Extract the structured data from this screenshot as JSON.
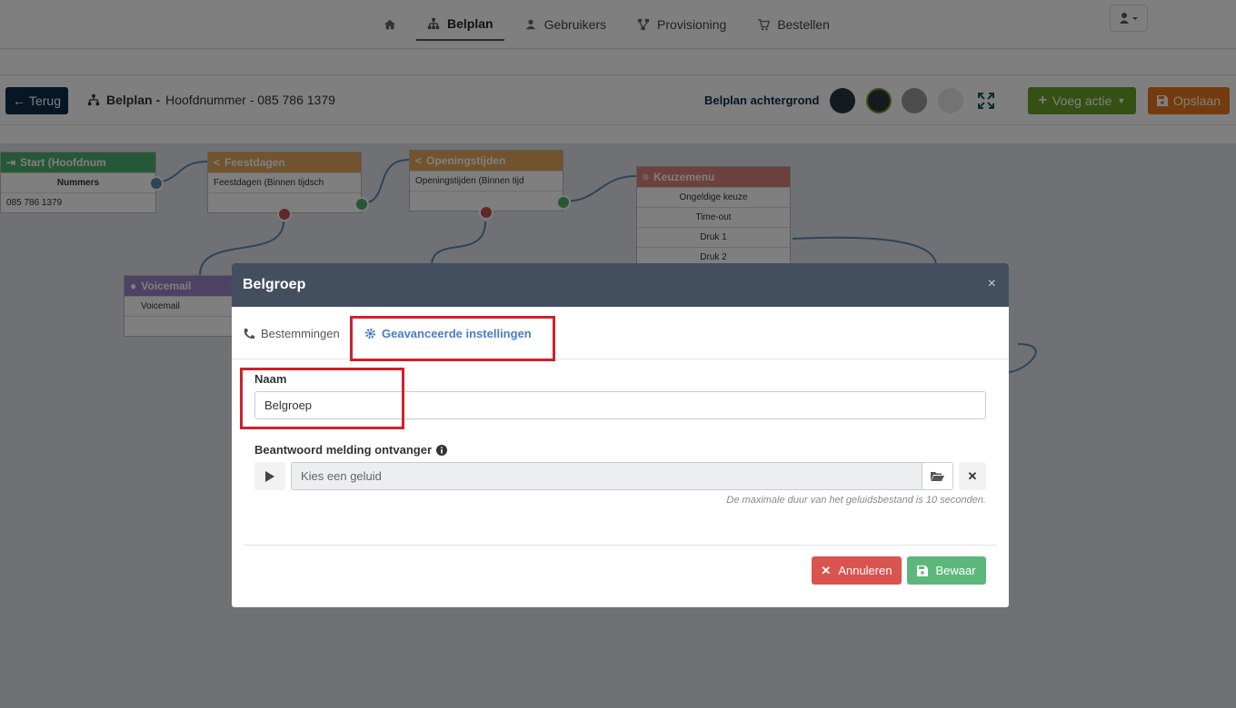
{
  "nav": {
    "items": [
      {
        "label": "",
        "icon": "home-icon"
      },
      {
        "label": "Belplan",
        "icon": "sitemap-icon",
        "active": true
      },
      {
        "label": "Gebruikers",
        "icon": "users-icon"
      },
      {
        "label": "Provisioning",
        "icon": "network-icon"
      },
      {
        "label": "Bestellen",
        "icon": "cart-icon"
      }
    ]
  },
  "toolbar": {
    "back_label": "Terug",
    "breadcrumb_bold": "Belplan -",
    "breadcrumb_rest": "Hoofdnummer - 085 786 1379",
    "background_label": "Belplan achtergrond",
    "swatches": [
      "#2b3540",
      "#2b3540",
      "#9a9a9a",
      "#e6e6e6"
    ],
    "add_action_label": "Voeg actie",
    "save_label": "Opslaan"
  },
  "nodes": {
    "start": {
      "title": "Start (Hoofdnum",
      "row1": "Nummers",
      "row2": "085 786 1379",
      "color": "#4caf6f"
    },
    "holidays": {
      "title": "Feestdagen",
      "row1": "Feestdagen (Binnen tijdsch",
      "color": "#e2a85a"
    },
    "hours": {
      "title": "Openingstijden",
      "row1": "Openingstijden (Binnen tijd",
      "color": "#e2a85a"
    },
    "menu": {
      "title": "Keuzemenu",
      "rows": [
        "Ongeldige keuze",
        "Time-out",
        "Druk 1",
        "Druk 2"
      ],
      "color": "#d9827d"
    },
    "voicemail": {
      "title": "Voicemail",
      "row1": "Voicemail",
      "color": "#9b84c9"
    }
  },
  "modal": {
    "title": "Belgroep",
    "close": "×",
    "tab_destinations": "Bestemmingen",
    "tab_advanced": "Geavanceerde instellingen",
    "name_label": "Naam",
    "name_value": "Belgroep",
    "answer_label": "Beantwoord melding ontvanger",
    "sound_placeholder": "Kies een geluid",
    "clear": "✕",
    "hint": "De maximale duur van het geluidsbestand is 10 seconden.",
    "cancel_label": "Annuleren",
    "save_label": "Bewaar"
  }
}
